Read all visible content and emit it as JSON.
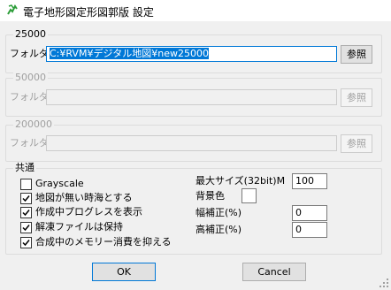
{
  "window": {
    "title": "電子地形図定形図郭版 設定"
  },
  "groups": [
    {
      "legend": "25000",
      "folder_label": "フォルダ",
      "folder_value": "C:¥RVM¥デジタル地図¥new25000",
      "browse_label": "参照",
      "enabled": true
    },
    {
      "legend": "50000",
      "folder_label": "フォルダ",
      "folder_value": "",
      "browse_label": "参照",
      "enabled": false
    },
    {
      "legend": "200000",
      "folder_label": "フォルダ",
      "folder_value": "",
      "browse_label": "参照",
      "enabled": false
    }
  ],
  "common": {
    "legend": "共通",
    "checkboxes": [
      {
        "label": "Grayscale",
        "checked": false
      },
      {
        "label": "地図が無い時海とする",
        "checked": true
      },
      {
        "label": "作成中プログレスを表示",
        "checked": true
      },
      {
        "label": "解凍ファイルは保持",
        "checked": true
      },
      {
        "label": "合成中のメモリー消費を抑える",
        "checked": true
      }
    ],
    "max_size_label": "最大サイズ(32bit)M",
    "max_size_value": "100",
    "bg_color_label": "背景色",
    "bg_color": "#ffffff",
    "width_corr_label": "幅補正(%)",
    "width_corr_value": "0",
    "height_corr_label": "高補正(%)",
    "height_corr_value": "0"
  },
  "buttons": {
    "ok": "OK",
    "cancel": "Cancel"
  },
  "colors": {
    "accent": "#0078d7",
    "icon_green": "#2e9e3a"
  }
}
